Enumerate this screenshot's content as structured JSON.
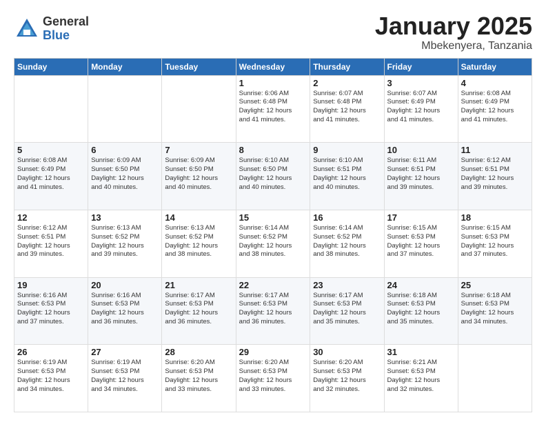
{
  "logo": {
    "general": "General",
    "blue": "Blue"
  },
  "header": {
    "month": "January 2025",
    "location": "Mbekenyera, Tanzania"
  },
  "weekdays": [
    "Sunday",
    "Monday",
    "Tuesday",
    "Wednesday",
    "Thursday",
    "Friday",
    "Saturday"
  ],
  "weeks": [
    [
      {
        "day": "",
        "info": ""
      },
      {
        "day": "",
        "info": ""
      },
      {
        "day": "",
        "info": ""
      },
      {
        "day": "1",
        "info": "Sunrise: 6:06 AM\nSunset: 6:48 PM\nDaylight: 12 hours\nand 41 minutes."
      },
      {
        "day": "2",
        "info": "Sunrise: 6:07 AM\nSunset: 6:48 PM\nDaylight: 12 hours\nand 41 minutes."
      },
      {
        "day": "3",
        "info": "Sunrise: 6:07 AM\nSunset: 6:49 PM\nDaylight: 12 hours\nand 41 minutes."
      },
      {
        "day": "4",
        "info": "Sunrise: 6:08 AM\nSunset: 6:49 PM\nDaylight: 12 hours\nand 41 minutes."
      }
    ],
    [
      {
        "day": "5",
        "info": "Sunrise: 6:08 AM\nSunset: 6:49 PM\nDaylight: 12 hours\nand 41 minutes."
      },
      {
        "day": "6",
        "info": "Sunrise: 6:09 AM\nSunset: 6:50 PM\nDaylight: 12 hours\nand 40 minutes."
      },
      {
        "day": "7",
        "info": "Sunrise: 6:09 AM\nSunset: 6:50 PM\nDaylight: 12 hours\nand 40 minutes."
      },
      {
        "day": "8",
        "info": "Sunrise: 6:10 AM\nSunset: 6:50 PM\nDaylight: 12 hours\nand 40 minutes."
      },
      {
        "day": "9",
        "info": "Sunrise: 6:10 AM\nSunset: 6:51 PM\nDaylight: 12 hours\nand 40 minutes."
      },
      {
        "day": "10",
        "info": "Sunrise: 6:11 AM\nSunset: 6:51 PM\nDaylight: 12 hours\nand 39 minutes."
      },
      {
        "day": "11",
        "info": "Sunrise: 6:12 AM\nSunset: 6:51 PM\nDaylight: 12 hours\nand 39 minutes."
      }
    ],
    [
      {
        "day": "12",
        "info": "Sunrise: 6:12 AM\nSunset: 6:51 PM\nDaylight: 12 hours\nand 39 minutes."
      },
      {
        "day": "13",
        "info": "Sunrise: 6:13 AM\nSunset: 6:52 PM\nDaylight: 12 hours\nand 39 minutes."
      },
      {
        "day": "14",
        "info": "Sunrise: 6:13 AM\nSunset: 6:52 PM\nDaylight: 12 hours\nand 38 minutes."
      },
      {
        "day": "15",
        "info": "Sunrise: 6:14 AM\nSunset: 6:52 PM\nDaylight: 12 hours\nand 38 minutes."
      },
      {
        "day": "16",
        "info": "Sunrise: 6:14 AM\nSunset: 6:52 PM\nDaylight: 12 hours\nand 38 minutes."
      },
      {
        "day": "17",
        "info": "Sunrise: 6:15 AM\nSunset: 6:53 PM\nDaylight: 12 hours\nand 37 minutes."
      },
      {
        "day": "18",
        "info": "Sunrise: 6:15 AM\nSunset: 6:53 PM\nDaylight: 12 hours\nand 37 minutes."
      }
    ],
    [
      {
        "day": "19",
        "info": "Sunrise: 6:16 AM\nSunset: 6:53 PM\nDaylight: 12 hours\nand 37 minutes."
      },
      {
        "day": "20",
        "info": "Sunrise: 6:16 AM\nSunset: 6:53 PM\nDaylight: 12 hours\nand 36 minutes."
      },
      {
        "day": "21",
        "info": "Sunrise: 6:17 AM\nSunset: 6:53 PM\nDaylight: 12 hours\nand 36 minutes."
      },
      {
        "day": "22",
        "info": "Sunrise: 6:17 AM\nSunset: 6:53 PM\nDaylight: 12 hours\nand 36 minutes."
      },
      {
        "day": "23",
        "info": "Sunrise: 6:17 AM\nSunset: 6:53 PM\nDaylight: 12 hours\nand 35 minutes."
      },
      {
        "day": "24",
        "info": "Sunrise: 6:18 AM\nSunset: 6:53 PM\nDaylight: 12 hours\nand 35 minutes."
      },
      {
        "day": "25",
        "info": "Sunrise: 6:18 AM\nSunset: 6:53 PM\nDaylight: 12 hours\nand 34 minutes."
      }
    ],
    [
      {
        "day": "26",
        "info": "Sunrise: 6:19 AM\nSunset: 6:53 PM\nDaylight: 12 hours\nand 34 minutes."
      },
      {
        "day": "27",
        "info": "Sunrise: 6:19 AM\nSunset: 6:53 PM\nDaylight: 12 hours\nand 34 minutes."
      },
      {
        "day": "28",
        "info": "Sunrise: 6:20 AM\nSunset: 6:53 PM\nDaylight: 12 hours\nand 33 minutes."
      },
      {
        "day": "29",
        "info": "Sunrise: 6:20 AM\nSunset: 6:53 PM\nDaylight: 12 hours\nand 33 minutes."
      },
      {
        "day": "30",
        "info": "Sunrise: 6:20 AM\nSunset: 6:53 PM\nDaylight: 12 hours\nand 32 minutes."
      },
      {
        "day": "31",
        "info": "Sunrise: 6:21 AM\nSunset: 6:53 PM\nDaylight: 12 hours\nand 32 minutes."
      },
      {
        "day": "",
        "info": ""
      }
    ]
  ]
}
